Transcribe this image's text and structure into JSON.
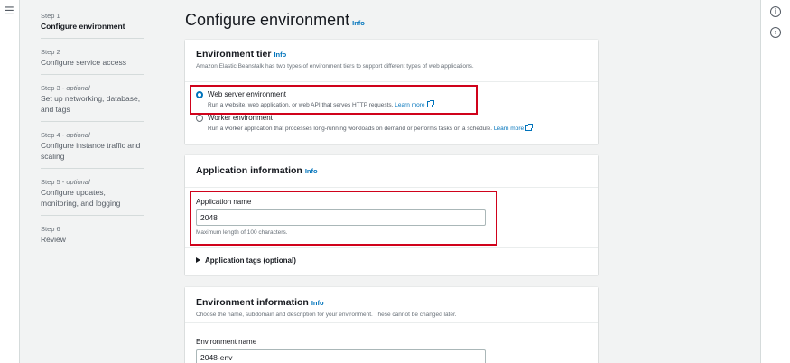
{
  "nav": {
    "steps": [
      {
        "num": "Step 1",
        "optional": "",
        "title": "Configure environment",
        "active": true
      },
      {
        "num": "Step 2",
        "optional": "",
        "title": "Configure service access",
        "active": false
      },
      {
        "num": "Step 3 - ",
        "optional": "optional",
        "title": "Set up networking, database, and tags",
        "active": false
      },
      {
        "num": "Step 4 - ",
        "optional": "optional",
        "title": "Configure instance traffic and scaling",
        "active": false
      },
      {
        "num": "Step 5 - ",
        "optional": "optional",
        "title": "Configure updates, monitoring, and logging",
        "active": false
      },
      {
        "num": "Step 6",
        "optional": "",
        "title": "Review",
        "active": false
      }
    ]
  },
  "page": {
    "title": "Configure environment",
    "info": "Info"
  },
  "tier": {
    "title": "Environment tier",
    "info": "Info",
    "desc": "Amazon Elastic Beanstalk has two types of environment tiers to support different types of web applications.",
    "web_label": "Web server environment",
    "web_desc": "Run a website, web application, or web API that serves HTTP requests.",
    "worker_label": "Worker environment",
    "worker_desc": "Run a worker application that processes long-running workloads on demand or performs tasks on a schedule.",
    "learn_more": "Learn more",
    "selected": "web"
  },
  "app": {
    "title": "Application information",
    "info": "Info",
    "name_label": "Application name",
    "name_value": "2048",
    "name_hint": "Maximum length of 100 characters.",
    "tags_label": "Application tags (optional)"
  },
  "env": {
    "title": "Environment information",
    "info": "Info",
    "desc": "Choose the name, subdomain and description for your environment. These cannot be changed later.",
    "name_label": "Environment name",
    "name_value": "2048-env"
  },
  "colors": {
    "highlight": "#d0021b",
    "link": "#0073bb"
  }
}
